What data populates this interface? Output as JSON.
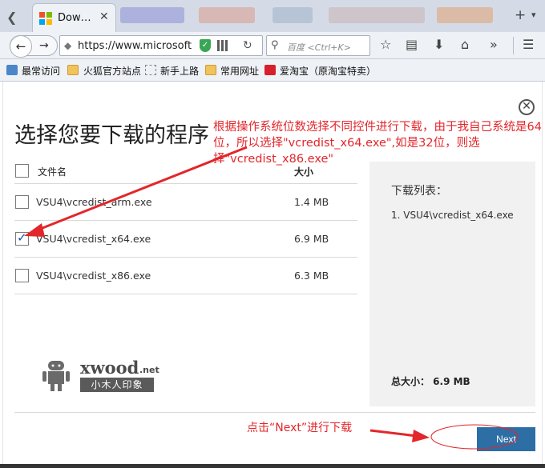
{
  "browser": {
    "tab_title": "Dow…",
    "url": "https://www.microsoft",
    "search_placeholder": "百度 <Ctrl+K>",
    "bookmarks": [
      "最常访问",
      "火狐官方站点",
      "新手上路",
      "常用网址",
      "爱淘宝（原淘宝特卖）"
    ]
  },
  "dialog": {
    "title": "选择您要下载的程序",
    "columns": {
      "name": "文件名",
      "size": "大小"
    },
    "rows": [
      {
        "name": "VSU4\\vcredist_arm.exe",
        "size": "1.4 MB",
        "checked": false
      },
      {
        "name": "VSU4\\vcredist_x64.exe",
        "size": "6.9 MB",
        "checked": true
      },
      {
        "name": "VSU4\\vcredist_x86.exe",
        "size": "6.3 MB",
        "checked": false
      }
    ],
    "panel": {
      "title": "下载列表：",
      "items": [
        "1. VSU4\\vcredist_x64.exe"
      ],
      "total": "总大小： 6.9 MB"
    },
    "next_label": "Next"
  },
  "watermark": {
    "top": "xwood",
    "suffix": ".net",
    "bottom": "小木人印象"
  },
  "annotations": {
    "note_main": "根据操作系统位数选择不同控件进行下载，由于我自己系统是64位，所以选择\"vcredist_x64.exe\",如是32位，则选择\"vcredist_x86.exe\"",
    "note_next": "点击“Next”进行下载"
  },
  "colors": {
    "annotation": "#e3262b",
    "next_button": "#2d6ea5"
  }
}
